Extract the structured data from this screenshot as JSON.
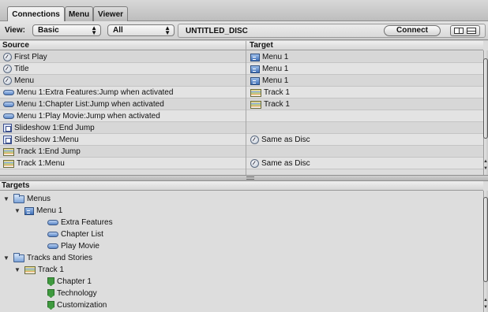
{
  "tabs": [
    {
      "label": "Connections",
      "active": true
    },
    {
      "label": "Menu",
      "active": false
    },
    {
      "label": "Viewer",
      "active": false
    }
  ],
  "viewbar": {
    "view_label": "View:",
    "view_value": "Basic",
    "filter_value": "All",
    "disc_name": "UNTITLED_DISC",
    "connect_label": "Connect"
  },
  "connections": {
    "headers": {
      "source": "Source",
      "target": "Target"
    },
    "rows": [
      {
        "source": "First Play",
        "source_icon": "first-play-icon",
        "target": "Menu 1",
        "target_icon": "menu-icon"
      },
      {
        "source": "Title",
        "source_icon": "title-icon",
        "target": "Menu 1",
        "target_icon": "menu-icon"
      },
      {
        "source": "Menu",
        "source_icon": "menu-remote-icon",
        "target": "Menu 1",
        "target_icon": "menu-icon"
      },
      {
        "source": "Menu 1:Extra Features:Jump when activated",
        "source_icon": "button-icon",
        "target": "Track 1",
        "target_icon": "track-icon"
      },
      {
        "source": "Menu 1:Chapter List:Jump when activated",
        "source_icon": "button-icon",
        "target": "Track 1",
        "target_icon": "track-icon"
      },
      {
        "source": "Menu 1:Play Movie:Jump when activated",
        "source_icon": "button-icon",
        "target": "",
        "target_icon": ""
      },
      {
        "source": "Slideshow 1:End Jump",
        "source_icon": "slideshow-icon",
        "target": "",
        "target_icon": ""
      },
      {
        "source": "Slideshow 1:Menu",
        "source_icon": "slideshow-icon",
        "target": "Same as Disc",
        "target_icon": "same-as-disc-icon"
      },
      {
        "source": "Track 1:End Jump",
        "source_icon": "track-icon",
        "target": "",
        "target_icon": ""
      },
      {
        "source": "Track 1:Menu",
        "source_icon": "track-icon",
        "target": "Same as Disc",
        "target_icon": "same-as-disc-icon"
      }
    ]
  },
  "targets": {
    "header": "Targets",
    "nodes": [
      {
        "label": "Menus",
        "icon": "folder-icon",
        "expanded": true
      },
      {
        "label": "Menu 1",
        "icon": "menu-icon",
        "expanded": true
      },
      {
        "label": "Extra Features",
        "icon": "button-icon"
      },
      {
        "label": "Chapter List",
        "icon": "button-icon"
      },
      {
        "label": "Play Movie",
        "icon": "button-icon"
      },
      {
        "label": "Tracks and Stories",
        "icon": "folder-icon",
        "expanded": true
      },
      {
        "label": "Track 1",
        "icon": "track-icon",
        "expanded": true
      },
      {
        "label": "Chapter 1",
        "icon": "chapter-marker-icon"
      },
      {
        "label": "Technology",
        "icon": "chapter-marker-icon"
      },
      {
        "label": "Customization",
        "icon": "chapter-marker-icon"
      }
    ]
  },
  "icons": {
    "disclosure_expanded": "▼",
    "popup_arrows_up": "▲",
    "popup_arrows_down": "▼",
    "scroll_up": "▲",
    "scroll_down": "▼"
  }
}
